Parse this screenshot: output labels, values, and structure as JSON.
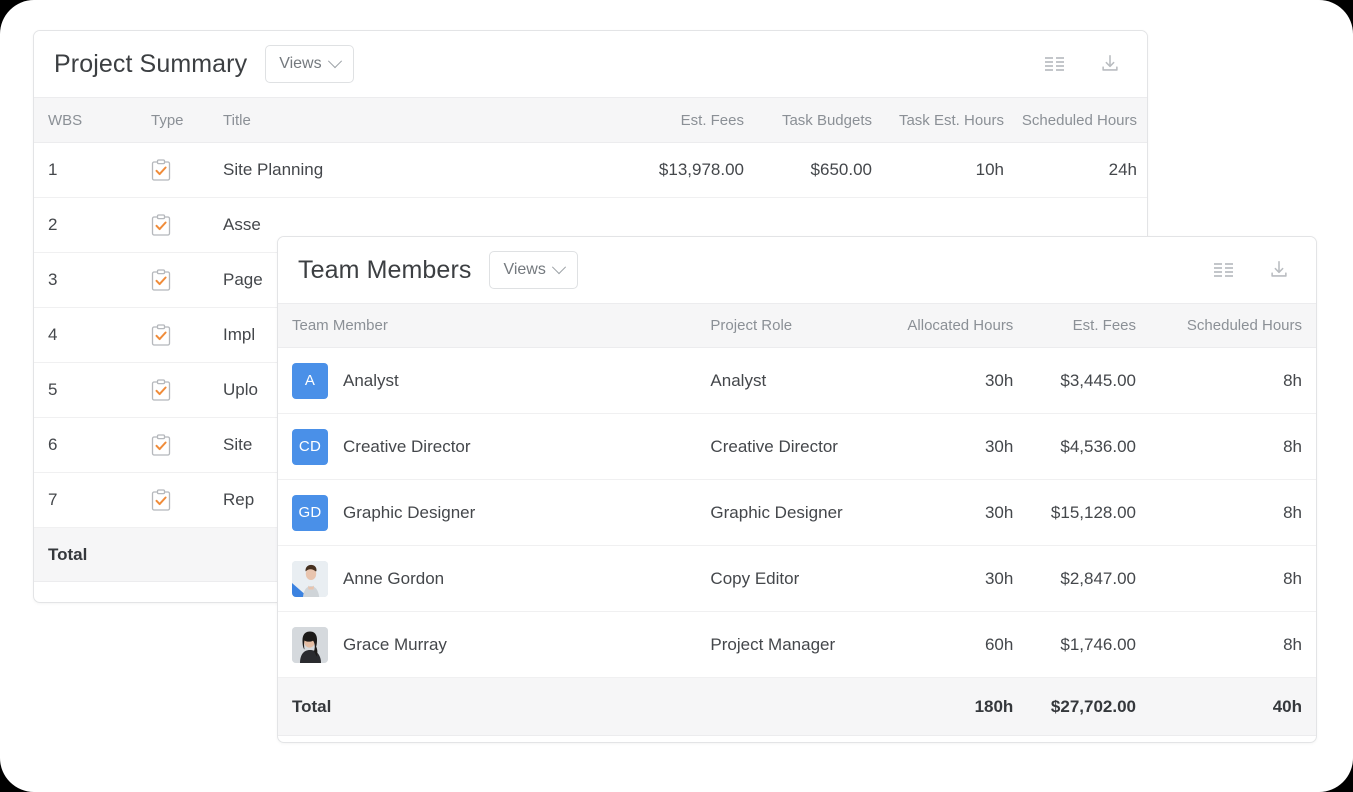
{
  "project_summary": {
    "title": "Project Summary",
    "views_label": "Views",
    "icons": {
      "columns": "columns-icon",
      "download": "download-icon"
    },
    "columns": [
      "WBS",
      "Type",
      "Title",
      "Est. Fees",
      "Task Budgets",
      "Task Est. Hours",
      "Scheduled Hours"
    ],
    "rows": [
      {
        "wbs": "1",
        "type": "task-clipboard-icon",
        "title": "Site Planning",
        "est_fees": "$13,978.00",
        "task_budgets": "$650.00",
        "task_est_hours": "10h",
        "scheduled_hours": "24h"
      },
      {
        "wbs": "2",
        "type": "task-clipboard-icon",
        "title": "Asse",
        "est_fees": "",
        "task_budgets": "",
        "task_est_hours": "",
        "scheduled_hours": ""
      },
      {
        "wbs": "3",
        "type": "task-clipboard-icon",
        "title": "Page",
        "est_fees": "",
        "task_budgets": "",
        "task_est_hours": "",
        "scheduled_hours": ""
      },
      {
        "wbs": "4",
        "type": "task-clipboard-icon",
        "title": "Impl",
        "est_fees": "",
        "task_budgets": "",
        "task_est_hours": "",
        "scheduled_hours": ""
      },
      {
        "wbs": "5",
        "type": "task-clipboard-icon",
        "title": "Uplo",
        "est_fees": "",
        "task_budgets": "",
        "task_est_hours": "",
        "scheduled_hours": ""
      },
      {
        "wbs": "6",
        "type": "task-clipboard-icon",
        "title": "Site",
        "est_fees": "",
        "task_budgets": "",
        "task_est_hours": "",
        "scheduled_hours": ""
      },
      {
        "wbs": "7",
        "type": "task-clipboard-icon",
        "title": "Rep",
        "est_fees": "",
        "task_budgets": "",
        "task_est_hours": "",
        "scheduled_hours": ""
      }
    ],
    "total": {
      "label": "Total",
      "est_fees": "",
      "task_budgets": "",
      "task_est_hours": "",
      "scheduled_hours": ""
    }
  },
  "team_members": {
    "title": "Team Members",
    "views_label": "Views",
    "icons": {
      "columns": "columns-icon",
      "download": "download-icon"
    },
    "columns": [
      "Team Member",
      "Project Role",
      "Allocated Hours",
      "Est. Fees",
      "Scheduled Hours"
    ],
    "rows": [
      {
        "avatar_type": "initials",
        "avatar": "A",
        "name": "Analyst",
        "role": "Analyst",
        "allocated": "30h",
        "est_fees": "$3,445.00",
        "scheduled": "8h"
      },
      {
        "avatar_type": "initials",
        "avatar": "CD",
        "name": "Creative Director",
        "role": "Creative Director",
        "allocated": "30h",
        "est_fees": "$4,536.00",
        "scheduled": "8h"
      },
      {
        "avatar_type": "initials",
        "avatar": "GD",
        "name": "Graphic Designer",
        "role": "Graphic Designer",
        "allocated": "30h",
        "est_fees": "$15,128.00",
        "scheduled": "8h"
      },
      {
        "avatar_type": "photo-light",
        "avatar": "",
        "name": "Anne Gordon",
        "role": "Copy Editor",
        "allocated": "30h",
        "est_fees": "$2,847.00",
        "scheduled": "8h"
      },
      {
        "avatar_type": "photo-dark",
        "avatar": "",
        "name": "Grace Murray",
        "role": "Project Manager",
        "allocated": "60h",
        "est_fees": "$1,746.00",
        "scheduled": "8h"
      }
    ],
    "total": {
      "label": "Total",
      "role": "",
      "allocated": "180h",
      "est_fees": "$27,702.00",
      "scheduled": "40h"
    }
  },
  "colors": {
    "avatar_blue": "#4a90e8",
    "check_orange": "#f08c3a",
    "header_bg": "#f6f6f7",
    "text_primary": "#44474b",
    "text_muted": "#8b9096"
  }
}
